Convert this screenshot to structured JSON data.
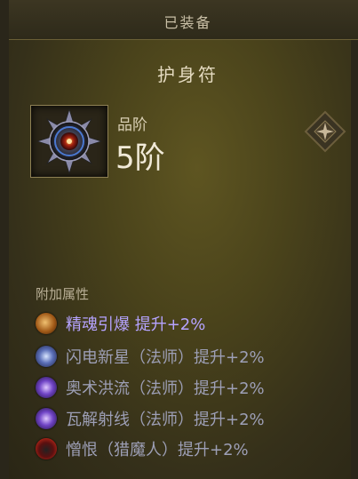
{
  "header": {
    "title": "已装备"
  },
  "item": {
    "name": "护身符",
    "grade_label": "品阶",
    "grade_value": "5阶"
  },
  "attributes": {
    "section_title": "附加属性",
    "rows": [
      {
        "text": "精魂引爆  提升+2%",
        "state": "active",
        "icon": "spirit-explosion-icon",
        "color": "#b5a3ff"
      },
      {
        "text": "闪电新星（法师）提升+2%",
        "state": "inactive",
        "icon": "lightning-nova-icon",
        "color": "#9d9fb6"
      },
      {
        "text": "奥术洪流（法师）提升+2%",
        "state": "inactive",
        "icon": "arcane-torrent-icon",
        "color": "#9d9fb6"
      },
      {
        "text": "瓦解射线（法师）提升+2%",
        "state": "inactive",
        "icon": "disintegrate-icon",
        "color": "#9d9fb6"
      },
      {
        "text": "憎恨（猎魔人）提升+2%",
        "state": "inactive",
        "icon": "hatred-icon",
        "color": "#9d9fb6"
      }
    ]
  }
}
